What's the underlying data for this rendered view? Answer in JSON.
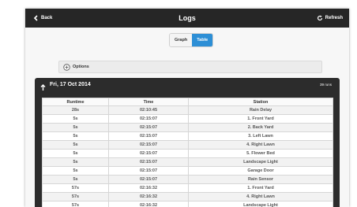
{
  "nav": {
    "back_label": "Back",
    "title": "Logs",
    "refresh_label": "Refresh"
  },
  "view_toggle": {
    "graph_label": "Graph",
    "table_label": "Table",
    "active": "Table"
  },
  "options": {
    "label": "Options"
  },
  "day": {
    "date": "Fri, 17 Oct 2014",
    "count": "39 runs"
  },
  "table": {
    "headers": [
      "Runtime",
      "Time",
      "Station"
    ],
    "rows": [
      [
        "28s",
        "02:10:45",
        "Rain Delay"
      ],
      [
        "5s",
        "02:15:07",
        "1. Front Yard"
      ],
      [
        "5s",
        "02:15:07",
        "2. Back Yard"
      ],
      [
        "5s",
        "02:15:07",
        "3. Left Lawn"
      ],
      [
        "5s",
        "02:15:07",
        "4. Right Lawn"
      ],
      [
        "5s",
        "02:15:07",
        "5. Flower Bed"
      ],
      [
        "5s",
        "02:15:07",
        "Landscape Light"
      ],
      [
        "5s",
        "02:15:07",
        "Garage Door"
      ],
      [
        "5s",
        "02:15:07",
        "Rain Sensor"
      ],
      [
        "57s",
        "02:16:32",
        "1. Front Yard"
      ],
      [
        "57s",
        "02:16:32",
        "4. Right Lawn"
      ],
      [
        "57s",
        "02:16:32",
        "Landscape Light"
      ]
    ]
  },
  "colors": {
    "topbar": "#262626",
    "accent": "#2d8fd6",
    "panel": "#2c2c2c"
  }
}
